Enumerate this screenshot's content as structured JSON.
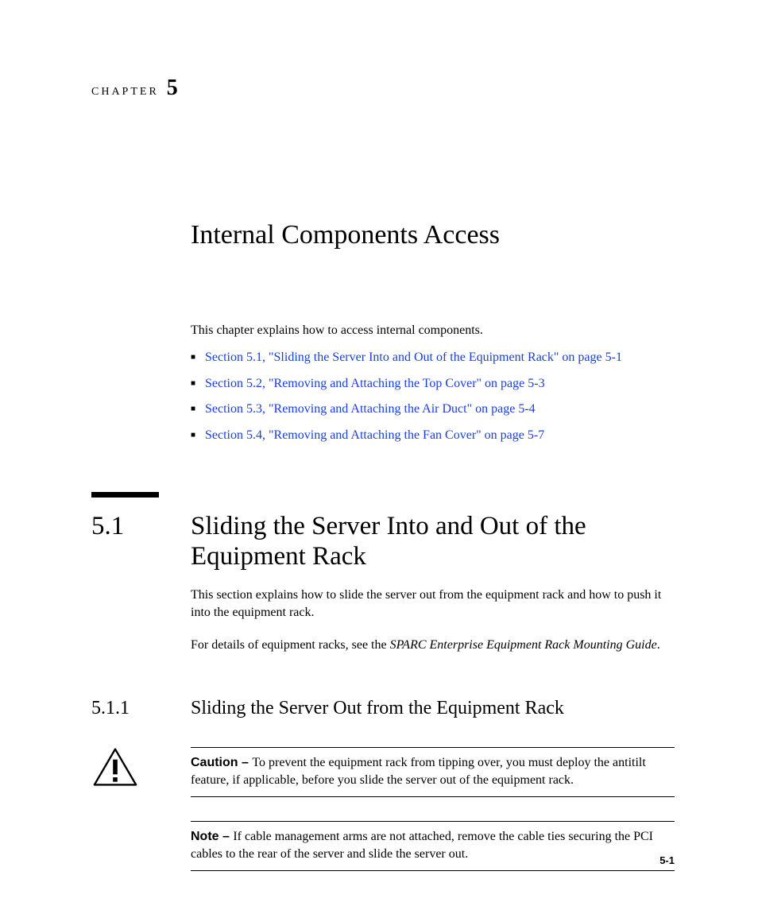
{
  "chapter": {
    "label": "CHAPTER",
    "number": "5",
    "title": "Internal Components Access",
    "intro": "This chapter explains how to access internal components.",
    "toc": [
      "Section 5.1, \"Sliding the Server Into and Out of the Equipment Rack\" on page 5-1",
      "Section 5.2, \"Removing and Attaching the Top Cover\" on page 5-3",
      "Section 5.3, \"Removing and Attaching the Air Duct\" on page 5-4",
      "Section 5.4, \"Removing and Attaching the Fan Cover\" on page 5-7"
    ]
  },
  "section": {
    "number": "5.1",
    "title": "Sliding the Server Into and Out of the Equipment Rack",
    "p1": "This section explains how to slide the server out from the equipment rack and how to push it into the equipment rack.",
    "p2_pre": "For details of equipment racks, see the ",
    "p2_italic": "SPARC Enterprise Equipment Rack Mounting Guide",
    "p2_post": "."
  },
  "subsection": {
    "number": "5.1.1",
    "title": "Sliding the Server Out from the Equipment Rack"
  },
  "caution": {
    "label": "Caution – ",
    "text": "To prevent the equipment rack from tipping over, you must deploy the antitilt feature, if applicable, before you slide the server out of the equipment rack."
  },
  "note": {
    "label": "Note – ",
    "text": "If cable management arms are not attached, remove the cable ties securing the PCI cables to the rear of the server and slide the server out."
  },
  "page_number": "5-1"
}
